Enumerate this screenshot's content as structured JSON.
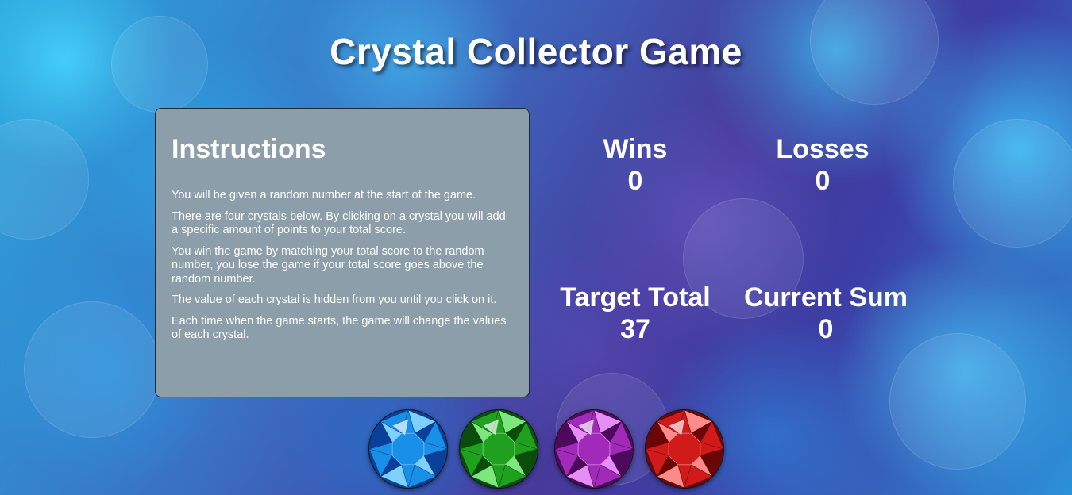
{
  "title": "Crystal Collector Game",
  "instructions": {
    "heading": "Instructions",
    "paragraphs": [
      "You will be given a random number at the start of the game.",
      "There are four crystals below. By clicking on a crystal you will add a specific amount of points to your total score.",
      "You win the game by matching your total score to the random number, you lose the game if your total score goes above the random number.",
      "The value of each crystal is hidden from you until you click on it.",
      "Each time when the game starts, the game will change the values of each crystal."
    ]
  },
  "stats": {
    "wins": {
      "label": "Wins",
      "value": "0"
    },
    "losses": {
      "label": "Losses",
      "value": "0"
    },
    "target": {
      "label": "Target Total",
      "value": "37"
    },
    "current": {
      "label": "Current Sum",
      "value": "0"
    }
  },
  "crystals": [
    {
      "name": "blue-crystal",
      "base": "#1a8fe8",
      "light": "#7fd0ff",
      "dark": "#0a3f9a"
    },
    {
      "name": "green-crystal",
      "base": "#1fa11f",
      "light": "#7ee67e",
      "dark": "#0a4d0a"
    },
    {
      "name": "purple-crystal",
      "base": "#a12ab8",
      "light": "#e68ef5",
      "dark": "#4d0a5c"
    },
    {
      "name": "red-crystal",
      "base": "#d11a1a",
      "light": "#ff8a8a",
      "dark": "#6a0606"
    }
  ]
}
